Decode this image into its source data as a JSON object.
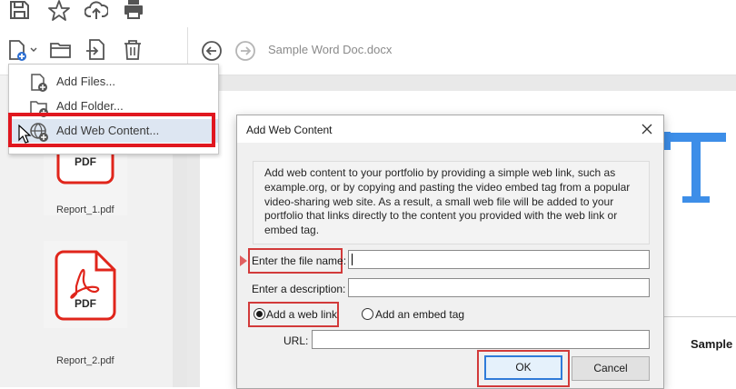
{
  "toolbar_icons": [
    "save-icon",
    "star-icon",
    "upload-icon",
    "print-icon"
  ],
  "portfolio_icons": [
    "add-file-menu-icon",
    "folder-icon",
    "extract-icon",
    "trash-icon",
    "back-arrow-icon",
    "forward-arrow-icon"
  ],
  "document": {
    "title": "Sample Word Doc.docx",
    "partial_heading": "Sample"
  },
  "menu": {
    "items": [
      {
        "label": "Add Files...",
        "icon": "add-file-icon"
      },
      {
        "label": "Add Folder...",
        "icon": "add-folder-icon"
      },
      {
        "label": "Add Web Content...",
        "icon": "web-content-icon"
      }
    ]
  },
  "files": [
    {
      "name": "Report_1.pdf",
      "badge": "PDF"
    },
    {
      "name": "Report_2.pdf",
      "badge": "PDF"
    }
  ],
  "dialog": {
    "title": "Add Web Content",
    "description": "Add web content to your portfolio by providing a simple web link, such as example.org, or by copying and pasting the video embed tag from a popular video-sharing web site. As a result, a small web file will be added to your portfolio that links directly to the content you provided with the web link or embed tag.",
    "file_name_label": "Enter the file name:",
    "file_name_value": "",
    "description_label": "Enter a description:",
    "description_value": "",
    "radio_web_link": "Add a web link",
    "radio_embed": "Add an embed tag",
    "selected_option": "Add a web link",
    "url_label": "URL:",
    "url_value": "",
    "ok_label": "OK",
    "cancel_label": "Cancel"
  },
  "colors": {
    "highlight_red": "#e0171f",
    "pdf_red": "#e0251b",
    "doc_blue": "#3d8ee8",
    "ok_border": "#2f7bd9"
  }
}
